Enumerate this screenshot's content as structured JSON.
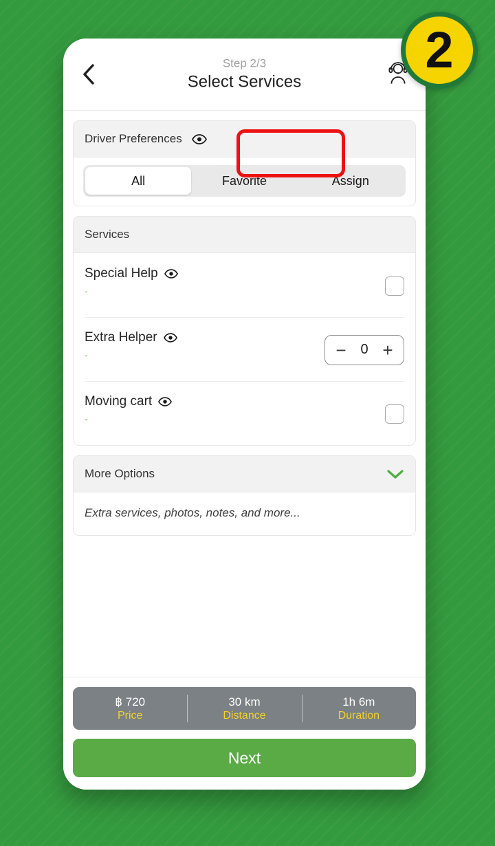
{
  "background": {
    "color": "#349a3e"
  },
  "step_badge": {
    "number": "2",
    "fill": "#f5d400",
    "border": "#1f7a3a"
  },
  "header": {
    "back_icon": "chevron-left-icon",
    "step_label": "Step 2/3",
    "title": "Select Services",
    "support_icon": "headset-support-icon"
  },
  "driver_preferences": {
    "title": "Driver Preferences",
    "info_icon": "eye-icon",
    "segments": [
      {
        "label": "All",
        "selected": true
      },
      {
        "label": "Favorite",
        "selected": false
      },
      {
        "label": "Assign",
        "selected": false,
        "highlighted": true
      }
    ]
  },
  "services": {
    "title": "Services",
    "items": [
      {
        "name": "Special Help",
        "info_icon": "eye-icon",
        "subtitle": "-",
        "control": "checkbox",
        "checked": false
      },
      {
        "name": "Extra Helper",
        "info_icon": "eye-icon",
        "subtitle": "-",
        "control": "stepper",
        "minus_label": "−",
        "value": "0",
        "plus_label": "+"
      },
      {
        "name": "Moving cart",
        "info_icon": "eye-icon",
        "subtitle": "-",
        "control": "checkbox",
        "checked": false
      }
    ]
  },
  "more_options": {
    "title": "More Options",
    "chevron_icon": "chevron-down-icon",
    "placeholder": "Extra services, photos, notes, and more..."
  },
  "footer": {
    "summary": [
      {
        "value": "฿ 720",
        "label": "Price"
      },
      {
        "value": "30 km",
        "label": "Distance"
      },
      {
        "value": "1h 6m",
        "label": "Duration"
      }
    ],
    "next_label": "Next",
    "accent_color": "#5aaa46",
    "label_color": "#f5d327"
  },
  "annotation": {
    "highlight_color": "#ee1111",
    "target": "Assign"
  }
}
